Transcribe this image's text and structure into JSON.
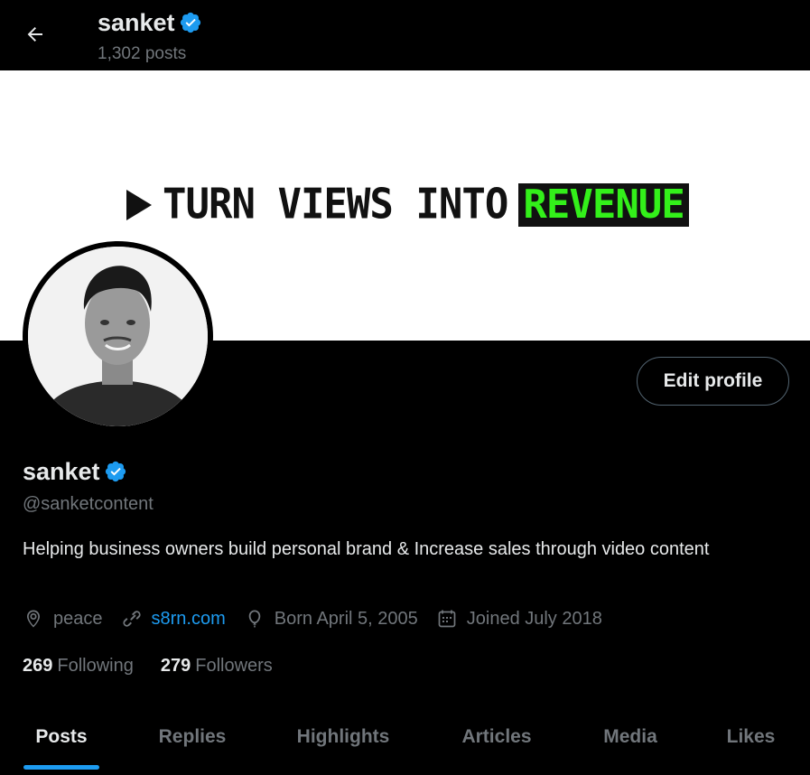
{
  "header": {
    "name": "sanket",
    "posts_count": "1,302 posts",
    "back_icon": "arrow-left-icon",
    "verified_icon": "verified-badge-icon"
  },
  "banner": {
    "text": "TURN VIEWS INTO",
    "highlight": "REVENUE",
    "highlight_color": "#33f01a"
  },
  "profile": {
    "name": "sanket",
    "handle": "@sanketcontent",
    "bio": "Helping business owners build personal brand & Increase sales through video content",
    "edit_button_label": "Edit profile",
    "location": "peace",
    "website": "s8rn.com",
    "birthday": "Born April 5, 2005",
    "joined": "Joined July 2018",
    "following_count": "269",
    "following_label": "Following",
    "followers_count": "279",
    "followers_label": "Followers"
  },
  "tabs": [
    {
      "label": "Posts",
      "active": true
    },
    {
      "label": "Replies",
      "active": false
    },
    {
      "label": "Highlights",
      "active": false
    },
    {
      "label": "Articles",
      "active": false
    },
    {
      "label": "Media",
      "active": false
    },
    {
      "label": "Likes",
      "active": false
    }
  ],
  "colors": {
    "accent": "#1d9bf0",
    "muted": "#71767b",
    "text": "#e7e9ea",
    "background": "#000000"
  }
}
